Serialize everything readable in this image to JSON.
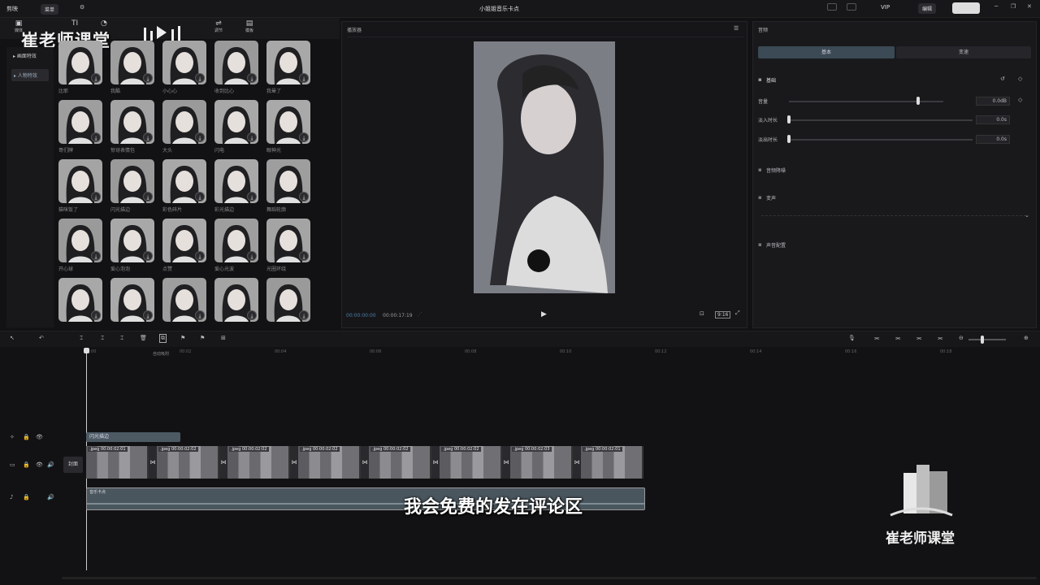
{
  "app": {
    "logo": "剪映",
    "menu": "菜单",
    "title": "小姐姐音乐卡点",
    "vip": "VIP"
  },
  "watermark": {
    "text": "崔老师课堂",
    "corner_text": "崔老师课堂"
  },
  "toolbar_tabs": [
    {
      "label": "媒体"
    },
    {
      "label": "文本"
    },
    {
      "label": "贴纸"
    },
    {
      "label": "特效"
    },
    {
      "label": "转场"
    },
    {
      "label": "滤镜"
    },
    {
      "label": "调节"
    },
    {
      "label": "模板"
    }
  ],
  "sidebar": {
    "items": [
      {
        "label": "▸ 画面特效"
      },
      {
        "label": "▸ 人物特效"
      }
    ]
  },
  "effects": [
    {
      "label": "比耶"
    },
    {
      "label": "我酷"
    },
    {
      "label": "小心心"
    },
    {
      "label": "收到比心"
    },
    {
      "label": "我晕了"
    },
    {
      "label": "哥们牌"
    },
    {
      "label": "惊讶表情包"
    },
    {
      "label": "大头"
    },
    {
      "label": "闪电"
    },
    {
      "label": "眼神光"
    },
    {
      "label": "猫咪饭了"
    },
    {
      "label": "闪光描边"
    },
    {
      "label": "彩色碎片"
    },
    {
      "label": "彩光描边"
    },
    {
      "label": "舞蹈轮廓"
    },
    {
      "label": "开心球"
    },
    {
      "label": "爱心泡泡"
    },
    {
      "label": "点赞"
    },
    {
      "label": "爱心光波"
    },
    {
      "label": "光圈环绕"
    },
    {
      "label": ""
    },
    {
      "label": ""
    },
    {
      "label": ""
    },
    {
      "label": ""
    },
    {
      "label": ""
    }
  ],
  "player": {
    "title": "播放器",
    "current": "00:00:00:00",
    "total": "00:00:17:19",
    "ratio": "9:16"
  },
  "right_panel": {
    "tab": "音频",
    "tabs": [
      "基本",
      "变速"
    ],
    "section": "基础",
    "volume": {
      "label": "音量",
      "value": "0.0dB"
    },
    "fade_in": {
      "label": "淡入时长",
      "value": "0.0s"
    },
    "fade_out": {
      "label": "淡出时长",
      "value": "0.0s"
    },
    "options": [
      "音频降噪",
      "变声",
      "声音配置"
    ]
  },
  "timeline": {
    "auto_label": "自动吸附",
    "ticks": [
      "00:00",
      "00:02",
      "00:04",
      "00:06",
      "00:08",
      "00:10",
      "00:12",
      "00:14",
      "00:16",
      "00:18"
    ],
    "effect_clip": "闪光描边",
    "cover_label": "封面",
    "audio_clip": "音乐卡点",
    "video_clips": [
      {
        "label": ".jpeg  00:00:02:01"
      },
      {
        "label": ".jpeg  00:00:02:02"
      },
      {
        "label": ".jpeg  00:00:02:02"
      },
      {
        "label": ".jpeg  00:00:02:02"
      },
      {
        "label": ".jpeg  00:00:02:02"
      },
      {
        "label": ".jpeg  00:00:02:02"
      },
      {
        "label": ".jpeg  00:00:02:03"
      },
      {
        "label": ".jpeg  00:00:02:01"
      }
    ]
  },
  "subtitle": "我会免费的发在评论区"
}
